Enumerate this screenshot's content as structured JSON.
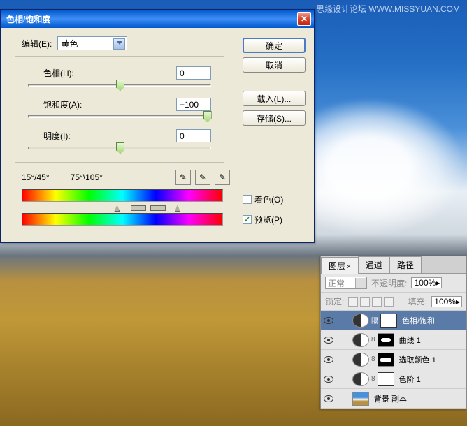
{
  "watermark": "思缘设计论坛  WWW.MISSYUAN.COM",
  "dialog": {
    "title": "色相/饱和度",
    "edit_label": "编辑(E):",
    "edit_value": "黄色",
    "hue_label": "色相(H):",
    "hue_value": "0",
    "sat_label": "饱和度(A):",
    "sat_value": "+100",
    "light_label": "明度(I):",
    "light_value": "0",
    "range_left": "15°/45°",
    "range_right": "75°\\105°",
    "ok": "确定",
    "cancel": "取消",
    "load": "载入(L)...",
    "save": "存储(S)...",
    "colorize": "着色(O)",
    "preview": "预览(P)"
  },
  "layers": {
    "tabs": [
      "图层",
      "通道",
      "路径"
    ],
    "blend": "正常",
    "opacity_label": "不透明度:",
    "opacity_value": "100%",
    "lock_label": "锁定:",
    "fill_label": "填充:",
    "fill_value": "100%",
    "items": [
      {
        "name": "色相/饱和...",
        "type": "adj",
        "mask": "white",
        "sel": true
      },
      {
        "name": "曲线 1",
        "type": "adj",
        "mask": "black"
      },
      {
        "name": "选取颜色 1",
        "type": "adj",
        "mask": "black"
      },
      {
        "name": "色阶 1",
        "type": "adj",
        "mask": "white"
      },
      {
        "name": "背景 副本",
        "type": "img"
      }
    ]
  }
}
